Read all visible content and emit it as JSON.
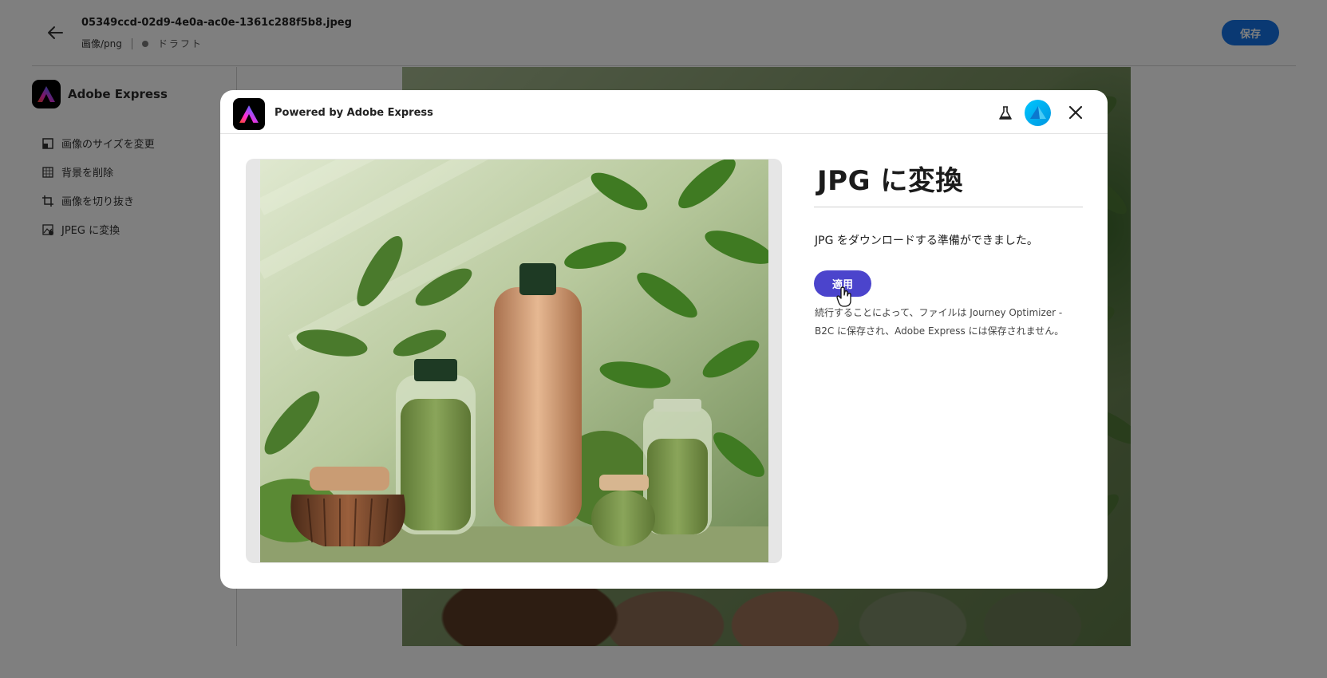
{
  "header": {
    "file_name": "05349ccd-02d9-4e0a-ac0e-1361c288f5b8.jpeg",
    "file_type": "画像/png",
    "status": "ドラフト",
    "save_label": "保存"
  },
  "sidebar": {
    "brand": "Adobe Express",
    "items": [
      {
        "label": "画像のサイズを変更",
        "icon": "resize-icon"
      },
      {
        "label": "背景を削除",
        "icon": "remove-background-icon"
      },
      {
        "label": "画像を切り抜き",
        "icon": "crop-icon"
      },
      {
        "label": "JPEG に変換",
        "icon": "convert-image-icon"
      }
    ]
  },
  "modal": {
    "powered_by": "Powered by Adobe Express",
    "title": "JPG に変換",
    "ready_message": "JPG をダウンロードする準備ができました。",
    "apply_label": "適用",
    "note_line1": "続行することによって、ファイルは Journey Optimizer -",
    "note_line2": "B2C に保存され、Adobe Express には保存されません。"
  },
  "colors": {
    "save_button": "#1473e6",
    "apply_button": "#4b44cc",
    "avatar": "#00b4f0"
  }
}
